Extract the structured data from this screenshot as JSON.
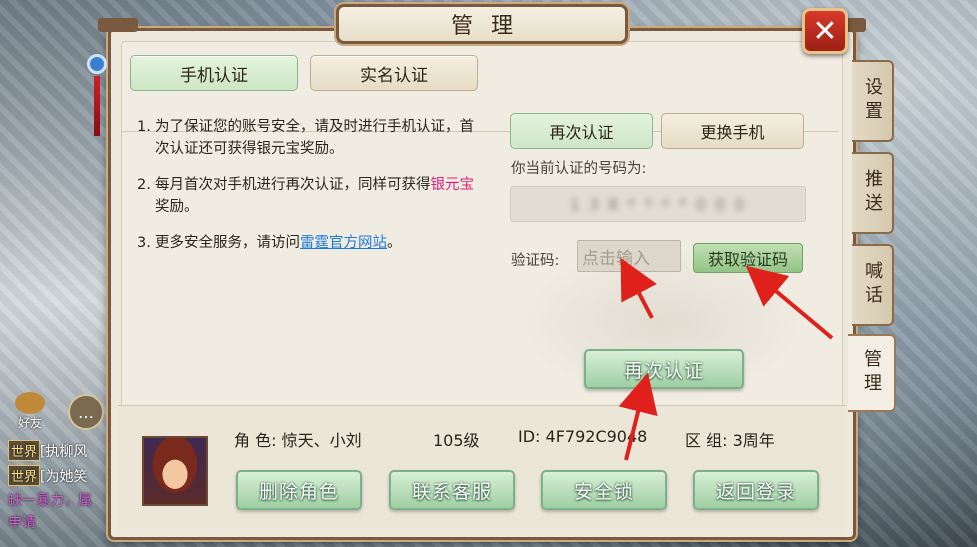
{
  "window": {
    "title": "管理"
  },
  "tabs": [
    {
      "label": "手机认证",
      "active": true
    },
    {
      "label": "实名认证",
      "active": false
    }
  ],
  "notes": {
    "n1_num": "1.",
    "n1_text": "为了保证您的账号安全，请及时进行手机认证，首次认证还可获得银元宝奖励。",
    "n2_num": "2.",
    "n2_pre": "每月首次对手机进行再次认证，同样可获得",
    "n2_highlight": "银元宝",
    "n2_post": "奖励。",
    "n3_num": "3.",
    "n3_pre": "更多安全服务，请访问",
    "n3_link": "雷霆官方网站",
    "n3_post": "。"
  },
  "phone_panel": {
    "reverify_tab": "再次认证",
    "change_phone": "更换手机",
    "current_label": "你当前认证的号码为:",
    "current_number": "1 3 8 * * * * 0 0 0",
    "code_label": "验证码:",
    "code_placeholder": "点击输入",
    "get_code": "获取验证码",
    "submit": "再次认证"
  },
  "side_tabs": [
    {
      "label": "设置",
      "active": false
    },
    {
      "label": "推送",
      "active": false
    },
    {
      "label": "喊话",
      "active": false
    },
    {
      "label": "管理",
      "active": true
    }
  ],
  "character": {
    "role_label": "角  色:",
    "role_value": "惊天、小刘",
    "level": "105级",
    "id_label": "ID:",
    "id_value": "4F792C9048",
    "zone_label": "区  组:",
    "zone_value": "3周年"
  },
  "bottom_buttons": [
    {
      "label": "删除角色"
    },
    {
      "label": "联系客服"
    },
    {
      "label": "安全锁"
    },
    {
      "label": "返回登录"
    }
  ],
  "hud": {
    "friends": "好友",
    "chat": [
      {
        "tag": "世界",
        "text": "[执柳风"
      },
      {
        "tag": "世界",
        "text": "[为她笑"
      }
    ],
    "notice_1": "缺一暴力，属",
    "notice_2": "申请"
  },
  "colors": {
    "accent_green": "#9fcfa3",
    "highlight_pink": "#e0207a",
    "link_blue": "#1d7be0",
    "close_red": "#d83a2a",
    "arrow_red": "#e0201a"
  }
}
